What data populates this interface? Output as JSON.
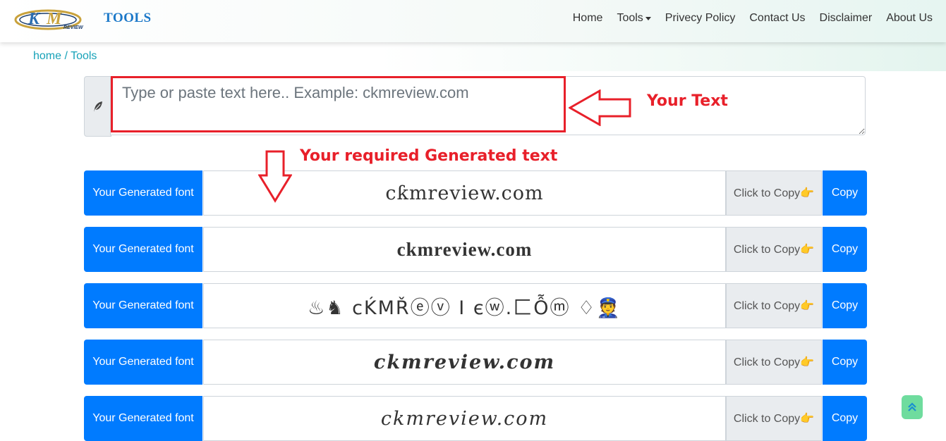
{
  "brand": {
    "logo_text": "KM",
    "logo_sub": "REVIEW",
    "name": "TOOLS"
  },
  "nav": [
    {
      "label": "Home"
    },
    {
      "label": "Tools"
    },
    {
      "label": "Privecy Policy"
    },
    {
      "label": "Contact Us"
    },
    {
      "label": "Disclaimer"
    },
    {
      "label": "About Us"
    }
  ],
  "breadcrumb": {
    "home": "home",
    "sep": " / ",
    "current": "Tools"
  },
  "input": {
    "placeholder": "Type or paste text here.. Example: ckmreview.com",
    "value": "",
    "icon": "feather-icon"
  },
  "annotations": {
    "your_text": "Your Text",
    "generated": "Your required Generated text"
  },
  "rows": [
    {
      "label": "Your Generated font",
      "output": "cƙmreview.com",
      "hint": "Click to Copy👉",
      "copy": "Copy"
    },
    {
      "label": "Your Generated font",
      "output": "ckmreview.com",
      "hint": "Click to Copy👉",
      "copy": "Copy"
    },
    {
      "label": "Your Generated font",
      "output": "♨♞  cḰMŘⓔⓥ Ⅰ єⓦ.匚Ỗⓜ  ♢👮",
      "hint": "Click to Copy👉",
      "copy": "Copy"
    },
    {
      "label": "Your Generated font",
      "output": "ckmreview.com",
      "hint": "Click to Copy👉",
      "copy": "Copy"
    },
    {
      "label": "Your Generated font",
      "output": "ckmreview.com",
      "hint": "Click to Copy👉",
      "copy": "Copy"
    }
  ],
  "colors": {
    "primary": "#007bff",
    "annotation_red": "#e8202a",
    "breadcrumb": "#17a2b8",
    "scroll_top": "#6fdc9e"
  }
}
